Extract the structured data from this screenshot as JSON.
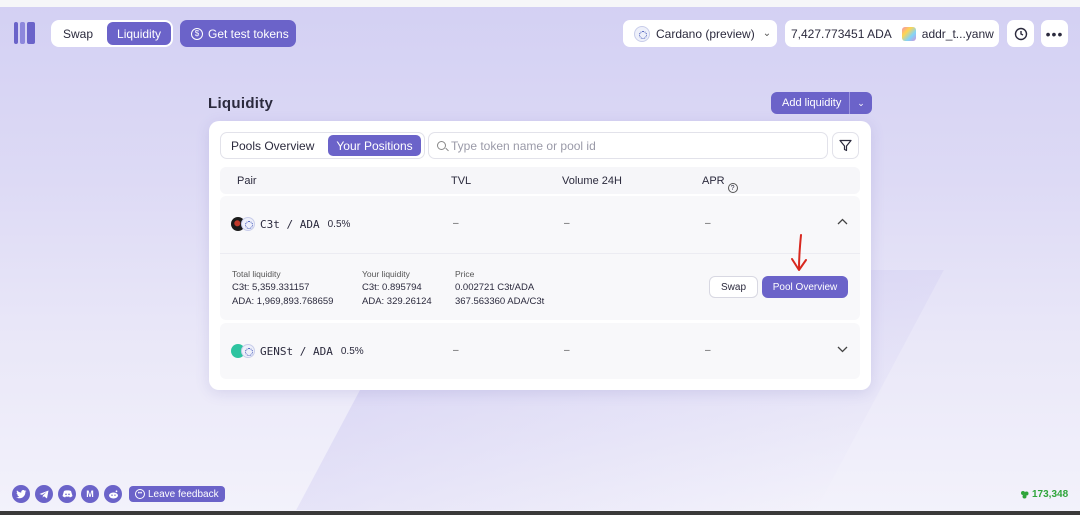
{
  "nav": {
    "tabs": [
      {
        "label": "Swap"
      },
      {
        "label": "Liquidity"
      }
    ],
    "test_tokens_label": "Get test tokens",
    "network_label": "Cardano (preview)",
    "balance": "7,427.773451 ADA",
    "address": "addr_t...yanw"
  },
  "page": {
    "title": "Liquidity",
    "add_liquidity_label": "Add liquidity"
  },
  "card": {
    "tabs": [
      {
        "label": "Pools Overview"
      },
      {
        "label": "Your Positions"
      }
    ],
    "search_placeholder": "Type token name or pool id",
    "columns": {
      "pair": "Pair",
      "tvl": "TVL",
      "volume": "Volume 24H",
      "apr": "APR"
    },
    "rows": [
      {
        "pair": "C3t / ADA",
        "fee": "0.5%",
        "tvl": "–",
        "volume": "–",
        "apr": "–",
        "expanded": true,
        "details": {
          "total_liquidity_label": "Total liquidity",
          "total_liquidity_1": "C3t: 5,359.331157",
          "total_liquidity_2": "ADA: 1,969,893.768659",
          "your_liquidity_label": "Your liquidity",
          "your_liquidity_1": "C3t: 0.895794",
          "your_liquidity_2": "ADA: 329.26124",
          "price_label": "Price",
          "price_1": "0.002721 C3t/ADA",
          "price_2": "367.563360 ADA/C3t",
          "swap_label": "Swap",
          "pool_overview_label": "Pool Overview"
        }
      },
      {
        "pair": "GENSt / ADA",
        "fee": "0.5%",
        "tvl": "–",
        "volume": "–",
        "apr": "–",
        "expanded": false
      }
    ]
  },
  "footer": {
    "feedback_label": "Leave feedback",
    "block_number": "173,348",
    "social": [
      "twitter-icon",
      "telegram-icon",
      "discord-icon",
      "medium-icon",
      "reddit-icon"
    ]
  },
  "colors": {
    "accent": "#6b63c9",
    "annotation_arrow": "#d8281f",
    "block_green": "#2fa53a"
  }
}
